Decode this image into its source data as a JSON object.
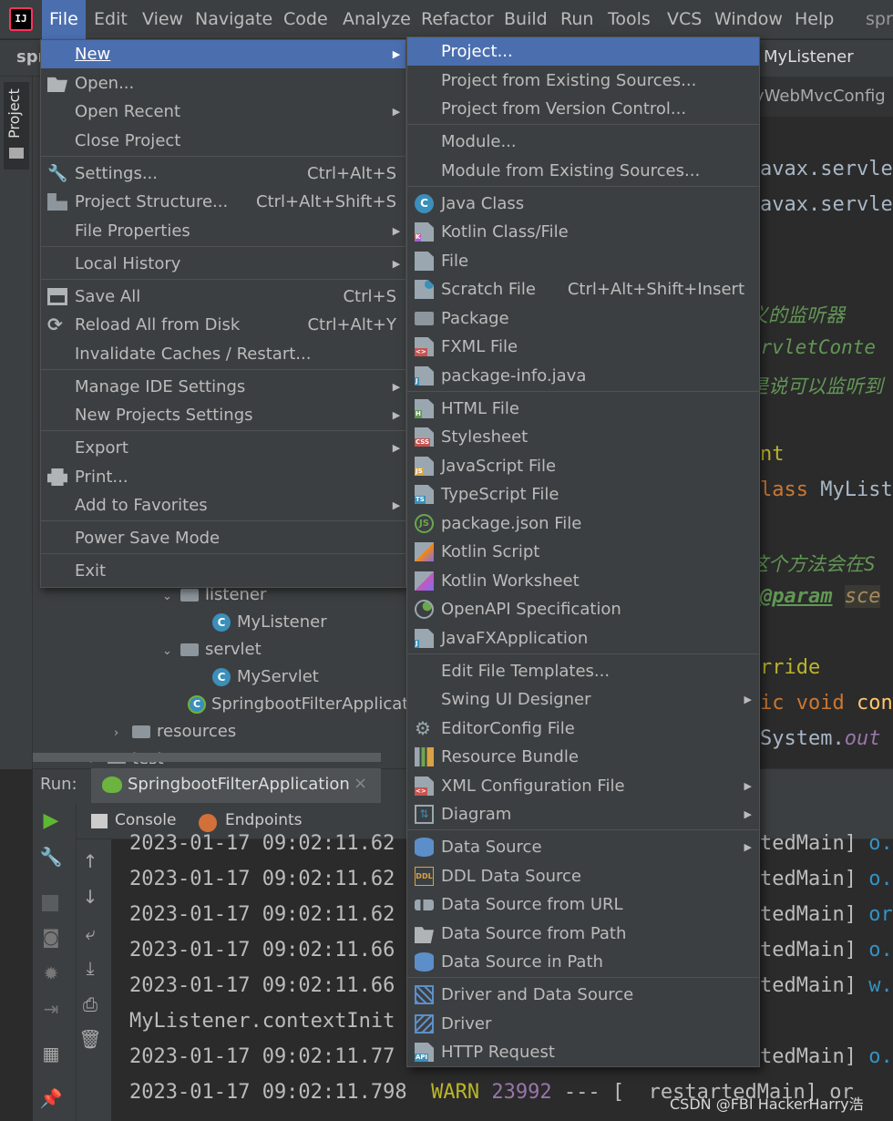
{
  "menubar": {
    "logo_text": "IJ",
    "items": [
      "File",
      "Edit",
      "View",
      "Navigate",
      "Code",
      "Analyze",
      "Refactor",
      "Build",
      "Run",
      "Tools",
      "VCS",
      "Window",
      "Help"
    ],
    "right_text": "spr"
  },
  "navbar": {
    "project_name": "spr"
  },
  "side_tab": {
    "label": "Project"
  },
  "project_tree": [
    {
      "label": "listener",
      "kind": "folder",
      "arrow": "⌄"
    },
    {
      "label": "MyListener",
      "kind": "class"
    },
    {
      "label": "servlet",
      "kind": "folder",
      "arrow": "⌄"
    },
    {
      "label": "MyServlet",
      "kind": "class"
    },
    {
      "label": "SpringbootFilterApplicat",
      "kind": "app"
    },
    {
      "label": "resources",
      "kind": "folder",
      "arrow": "›"
    },
    {
      "label": "test",
      "kind": "folder",
      "arrow": "›"
    }
  ],
  "editor": {
    "tab_label": "MyListener",
    "breadcrumb": "yWebMvcConfig",
    "lines": [
      {
        "text": "avax.servle",
        "style": "plain"
      },
      {
        "text": "avax.servle",
        "style": "plain"
      },
      {
        "text": "义的监听器",
        "style": "comment"
      },
      {
        "text": "ervletConte",
        "style": "comment"
      },
      {
        "text": "是说可以监听到",
        "style": "comment"
      },
      {
        "text": "nt",
        "style": "ann"
      },
      {
        "text": "lass MyList",
        "style": "kwplain"
      },
      {
        "text": "这个方法会在S",
        "style": "comment"
      },
      {
        "text": "@param sce",
        "style": "param"
      },
      {
        "text": "rride",
        "style": "ann"
      },
      {
        "text": "ic void con",
        "style": "kwplain"
      },
      {
        "text": "System.out",
        "style": "field"
      }
    ]
  },
  "file_menu": {
    "items": [
      {
        "label": "New",
        "mnemonic": "N",
        "submenu": true,
        "highlighted": true
      },
      {
        "label": "Open...",
        "icon": "folder-open-icon"
      },
      {
        "label": "Open Recent",
        "submenu": true
      },
      {
        "label": "Close Project"
      },
      {
        "separator": true
      },
      {
        "label": "Settings...",
        "shortcut": "Ctrl+Alt+S",
        "icon": "wrench-icon"
      },
      {
        "label": "Project Structure...",
        "shortcut": "Ctrl+Alt+Shift+S",
        "icon": "project-structure-icon"
      },
      {
        "label": "File Properties",
        "submenu": true
      },
      {
        "separator": true
      },
      {
        "label": "Local History",
        "submenu": true
      },
      {
        "separator": true
      },
      {
        "label": "Save All",
        "shortcut": "Ctrl+S",
        "icon": "save-icon"
      },
      {
        "label": "Reload All from Disk",
        "shortcut": "Ctrl+Alt+Y",
        "icon": "reload-icon"
      },
      {
        "label": "Invalidate Caches / Restart..."
      },
      {
        "separator": true
      },
      {
        "label": "Manage IDE Settings",
        "submenu": true
      },
      {
        "label": "New Projects Settings",
        "submenu": true
      },
      {
        "separator": true
      },
      {
        "label": "Export",
        "submenu": true
      },
      {
        "label": "Print...",
        "icon": "print-icon"
      },
      {
        "label": "Add to Favorites",
        "submenu": true
      },
      {
        "separator": true
      },
      {
        "label": "Power Save Mode"
      },
      {
        "separator": true
      },
      {
        "label": "Exit"
      }
    ]
  },
  "new_menu": {
    "items": [
      {
        "label": "Project...",
        "highlighted": true
      },
      {
        "label": "Project from Existing Sources..."
      },
      {
        "label": "Project from Version Control..."
      },
      {
        "separator": true
      },
      {
        "label": "Module..."
      },
      {
        "label": "Module from Existing Sources..."
      },
      {
        "separator": true
      },
      {
        "label": "Java Class",
        "icon": "java-class-icon"
      },
      {
        "label": "Kotlin Class/File",
        "icon": "kotlin-file-icon"
      },
      {
        "label": "File",
        "icon": "file-icon"
      },
      {
        "label": "Scratch File",
        "shortcut": "Ctrl+Alt+Shift+Insert",
        "icon": "scratch-file-icon"
      },
      {
        "label": "Package",
        "icon": "package-icon"
      },
      {
        "label": "FXML File",
        "icon": "fxml-file-icon"
      },
      {
        "label": "package-info.java",
        "icon": "package-info-icon"
      },
      {
        "separator": true
      },
      {
        "label": "HTML File",
        "icon": "html-file-icon"
      },
      {
        "label": "Stylesheet",
        "icon": "css-file-icon"
      },
      {
        "label": "JavaScript File",
        "icon": "js-file-icon"
      },
      {
        "label": "TypeScript File",
        "icon": "ts-file-icon"
      },
      {
        "label": "package.json File",
        "icon": "nodejs-icon"
      },
      {
        "label": "Kotlin Script",
        "icon": "kotlin-script-icon"
      },
      {
        "label": "Kotlin Worksheet",
        "icon": "kotlin-worksheet-icon"
      },
      {
        "label": "OpenAPI Specification",
        "icon": "openapi-icon"
      },
      {
        "label": "JavaFXApplication",
        "icon": "javafx-icon"
      },
      {
        "separator": true
      },
      {
        "label": "Edit File Templates..."
      },
      {
        "label": "Swing UI Designer",
        "submenu": true
      },
      {
        "label": "EditorConfig File",
        "icon": "editorconfig-icon"
      },
      {
        "label": "Resource Bundle",
        "icon": "resource-bundle-icon"
      },
      {
        "label": "XML Configuration File",
        "submenu": true,
        "icon": "xml-file-icon"
      },
      {
        "label": "Diagram",
        "submenu": true,
        "icon": "diagram-icon"
      },
      {
        "separator": true
      },
      {
        "label": "Data Source",
        "submenu": true,
        "icon": "database-icon"
      },
      {
        "label": "DDL Data Source",
        "icon": "ddl-icon"
      },
      {
        "label": "Data Source from URL",
        "icon": "datasource-url-icon"
      },
      {
        "label": "Data Source from Path",
        "icon": "folder-open-icon"
      },
      {
        "label": "Data Source in Path",
        "icon": "database-icon"
      },
      {
        "separator": true
      },
      {
        "label": "Driver and Data Source",
        "icon": "driver-datasource-icon"
      },
      {
        "label": "Driver",
        "icon": "driver-icon"
      },
      {
        "label": "HTTP Request",
        "icon": "api-icon"
      }
    ]
  },
  "run_panel": {
    "label": "Run:",
    "config_name": "SpringbootFilterApplication",
    "close_glyph": "×",
    "tabs": [
      "Console",
      "Endpoints"
    ],
    "console_lines": [
      {
        "left": "2023-01-17 09:02:11.62",
        "right_bracket": "tedMain]",
        "right_tail": "o."
      },
      {
        "left": "2023-01-17 09:02:11.62",
        "right_bracket": "tedMain]",
        "right_tail": "o."
      },
      {
        "left": "2023-01-17 09:02:11.62",
        "right_bracket": "tedMain]",
        "right_tail": "or"
      },
      {
        "left": "2023-01-17 09:02:11.66",
        "right_bracket": "tedMain]",
        "right_tail": "o."
      },
      {
        "left": "2023-01-17 09:02:11.66",
        "right_bracket": "tedMain]",
        "right_tail": "w."
      },
      {
        "left": "MyListener.contextInit",
        "right_bracket": "",
        "right_tail": ""
      },
      {
        "left": "2023-01-17 09:02:11.77",
        "right_bracket": "tedMain]",
        "right_tail": "o."
      },
      {
        "left": "2023-01-17 09:02:11.798",
        "level": "WARN",
        "pid": "23992",
        "sep": "--- [",
        "right_bracket": "restartedMain]",
        "right_tail": "or"
      }
    ]
  },
  "watermark": "CSDN @FBI HackerHarry浩",
  "colors": {
    "highlight": "#4b6eaf",
    "menu_bg": "#3c3f41",
    "editor_bg": "#2b2b2b",
    "warn": "#bbb529",
    "pid": "#9876aa"
  }
}
